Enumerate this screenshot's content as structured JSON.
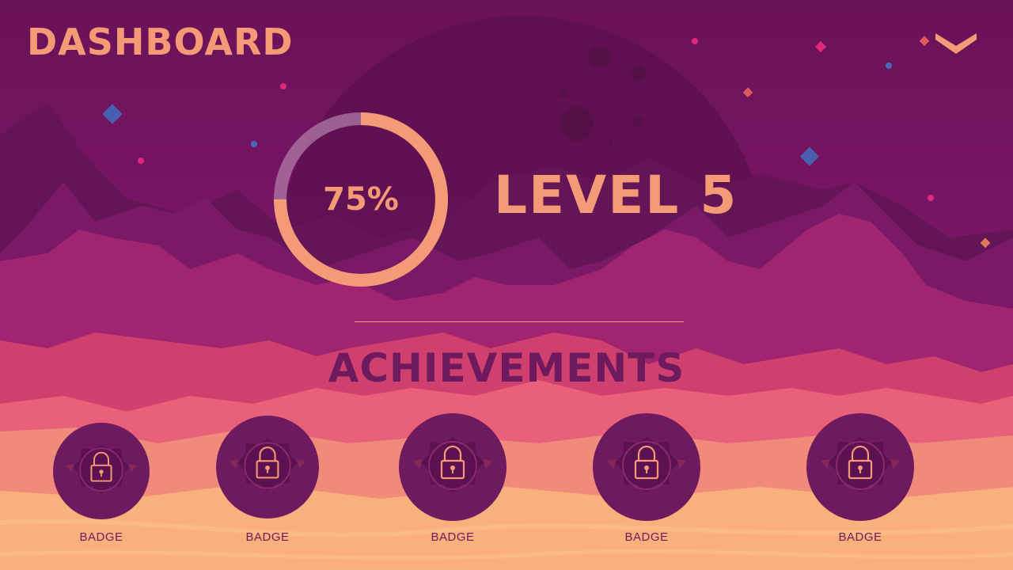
{
  "header": {
    "title": "DASHBOARD",
    "menu_icon": "chevron-down-icon"
  },
  "progress": {
    "value": 0.75,
    "label": "75%"
  },
  "level": {
    "label": "LEVEL 5"
  },
  "achievements": {
    "title": "ACHIEVEMENTS",
    "badges": [
      {
        "label": "BADGE",
        "icon": "lock-icon",
        "locked": true
      },
      {
        "label": "BADGE",
        "icon": "lock-icon",
        "locked": true
      },
      {
        "label": "BADGE",
        "icon": "lock-icon",
        "locked": true
      },
      {
        "label": "BADGE",
        "icon": "lock-icon",
        "locked": true
      },
      {
        "label": "BADGE",
        "icon": "lock-icon",
        "locked": true
      }
    ]
  },
  "colors": {
    "accent": "#f59a76",
    "badge_fill": "#6e1a5e",
    "sky_top": "#6a1258",
    "ground": "#fab07c"
  }
}
